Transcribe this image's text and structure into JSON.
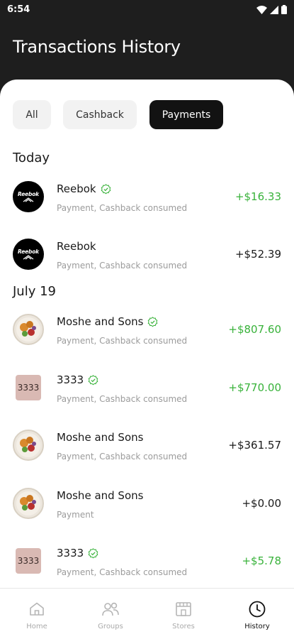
{
  "status": {
    "time": "6:54"
  },
  "header": {
    "title": "Transactions History"
  },
  "filters": {
    "all": "All",
    "cashback": "Cashback",
    "payments": "Payments",
    "active": "payments"
  },
  "sections": {
    "today": "Today",
    "july19": "July 19"
  },
  "transactions": [
    {
      "merchant": "Reebok",
      "detail": "Payment, Cashback consumed",
      "amount": "+$16.33",
      "verified": true,
      "avatar": "reebok-logo",
      "avatar_text": "Reebok"
    },
    {
      "merchant": "Reebok",
      "detail": "Payment, Cashback consumed",
      "amount": "+$52.39",
      "verified": false,
      "avatar": "reebok-logo",
      "avatar_text": "Reebok"
    },
    {
      "merchant": "Moshe and Sons",
      "detail": "Payment, Cashback consumed",
      "amount": "+$807.60",
      "verified": true,
      "avatar": "food-plate"
    },
    {
      "merchant": "3333",
      "detail": "Payment, Cashback consumed",
      "amount": "+$770.00",
      "verified": true,
      "avatar": "text-tile",
      "avatar_text": "3333"
    },
    {
      "merchant": "Moshe and Sons",
      "detail": "Payment, Cashback consumed",
      "amount": "+$361.57",
      "verified": false,
      "avatar": "food-plate"
    },
    {
      "merchant": "Moshe and Sons",
      "detail": "Payment",
      "amount": "+$0.00",
      "verified": false,
      "avatar": "food-plate"
    },
    {
      "merchant": "3333",
      "detail": "Payment, Cashback consumed",
      "amount": "+$5.78",
      "verified": true,
      "avatar": "text-tile",
      "avatar_text": "3333"
    }
  ],
  "nav": {
    "home": "Home",
    "groups": "Groups",
    "stores": "Stores",
    "history": "History",
    "active": "history"
  },
  "colors": {
    "accent_green": "#38b23a",
    "dark": "#1e1e1e",
    "active_chip": "#121212"
  }
}
